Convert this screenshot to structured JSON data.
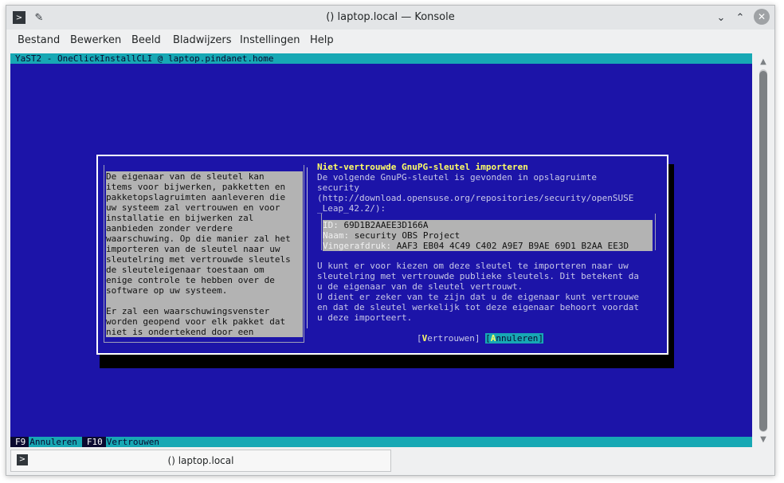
{
  "window": {
    "title": "() laptop.local — Konsole",
    "icons": {
      "app": "terminal-icon",
      "pin": "pin-icon",
      "minimize": "chevron-down-icon",
      "maximize": "chevron-up-icon",
      "close": "close-icon"
    }
  },
  "menubar": {
    "items": [
      "Bestand",
      "Bewerken",
      "Beeld",
      "Bladwijzers",
      "Instellingen",
      "Help"
    ]
  },
  "terminal": {
    "top_bar": "YaST2 - OneClickInstallCLI @ laptop.pindanet.home",
    "dialog": {
      "left_text": "De eigenaar van de sleutel kan\nitems voor bijwerken, pakketten en\npakketopslagruimten aanleveren die\nuw systeem zal vertrouwen en voor\ninstallatie en bijwerken zal\naanbieden zonder verdere\nwaarschuwing. Op die manier zal het\nimporteren van de sleutel naar uw\nsleutelring met vertrouwde sleutels\nde sleuteleigenaar toestaan om\nenige controle te hebben over de\nsoftware op uw systeem.\n\nEr zal een waarschuwingsvenster\nworden geopend voor elk pakket dat\nniet is ondertekend door een",
      "heading": "Niet-vertrouwde GnuPG-sleutel importeren",
      "description": "De volgende GnuPG-sleutel is gevonden in opslagruimte\nsecurity\n(http://download.opensuse.org/repositories/security/openSUSE\n_Leap_42.2/):",
      "key": {
        "id_label": "ID:",
        "id_value": "69D1B2AAEE3D166A",
        "name_label": "Naam:",
        "name_value": "security OBS Project",
        "fp_label": "Vingerafdruk:",
        "fp_value": "AAF3 EB04 4C49 C402 A9E7 B9AE 69D1 B2AA EE3D"
      },
      "explanation": "U kunt er voor kiezen om deze sleutel te importeren naar uw\nsleutelring met vertrouwde publieke sleutels. Dit betekent da\nu de eigenaar van de sleutel vertrouwt.\nU dient er zeker van te zijn dat u de eigenaar kunt vertrouwe\nen dat de sleutel werkelijk tot deze eigenaar behoort voordat\nu deze importeert.",
      "buttons": {
        "trust_hot": "V",
        "trust_rest": "ertrouwen",
        "cancel_hot": "A",
        "cancel_rest": "nnuleren"
      }
    },
    "bottom_bar": {
      "f9_key": "F9",
      "f9_label": "Annuleren",
      "f10_key": "F10",
      "f10_label": "Vertrouwen"
    }
  },
  "tab": {
    "label": "() laptop.local"
  }
}
